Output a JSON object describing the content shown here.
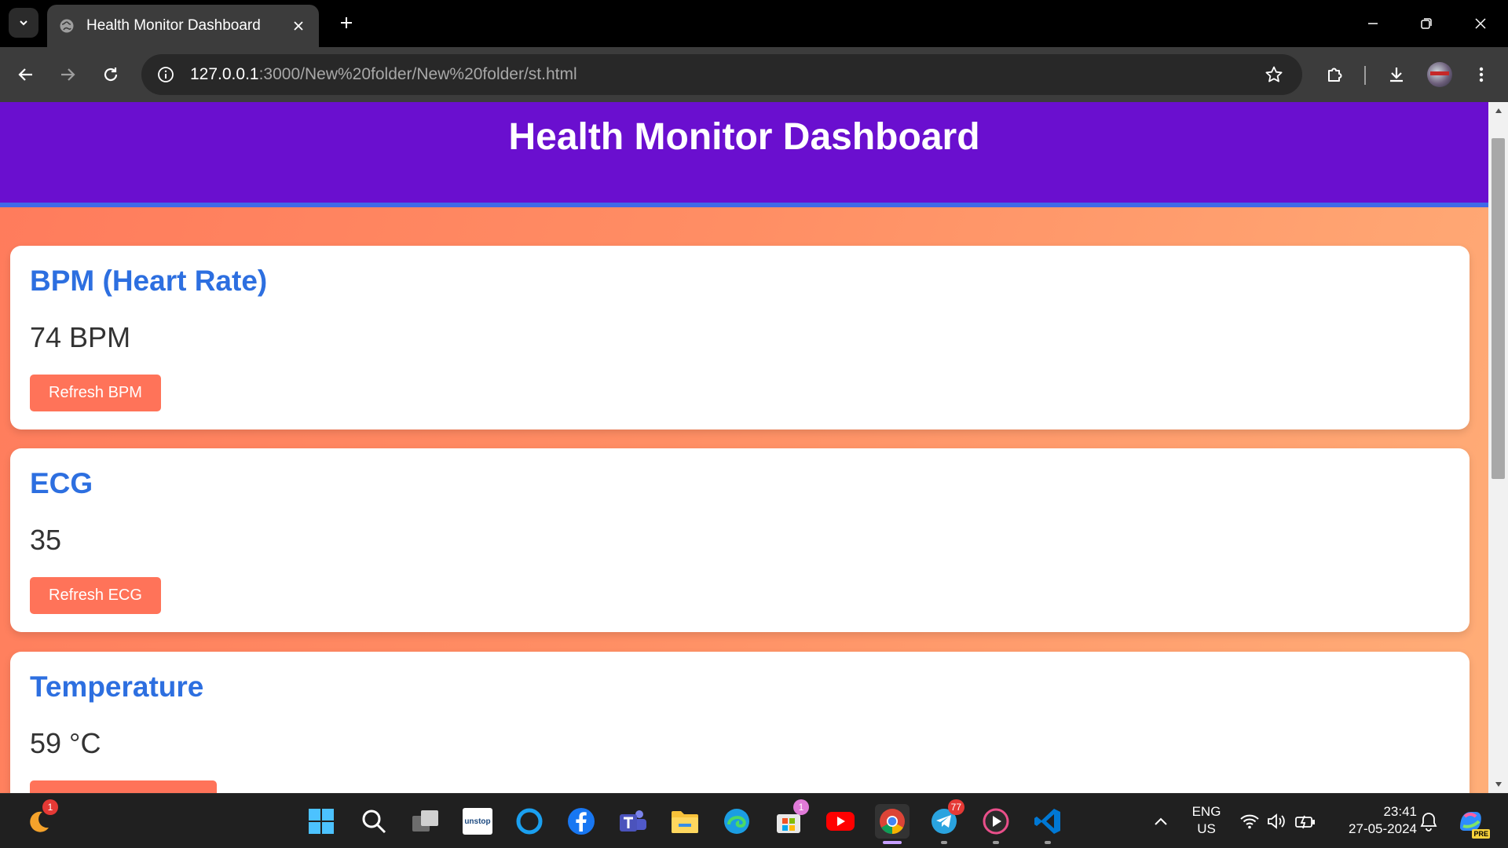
{
  "browser": {
    "tab_title": "Health Monitor Dashboard",
    "url_host": "127.0.0.1",
    "url_rest": ":3000/New%20folder/New%20folder/st.html"
  },
  "page": {
    "header_title": "Health Monitor Dashboard",
    "cards": [
      {
        "title": "BPM (Heart Rate)",
        "value": "74 BPM",
        "button": "Refresh BPM"
      },
      {
        "title": "ECG",
        "value": "35",
        "button": "Refresh ECG"
      },
      {
        "title": "Temperature",
        "value": "59 °C",
        "button": ""
      }
    ]
  },
  "taskbar": {
    "apps": [
      "weather",
      "start",
      "search",
      "task-view",
      "unstop",
      "cortana",
      "facebook",
      "teams",
      "file-explorer",
      "edge",
      "microsoft-store",
      "youtube",
      "chrome",
      "telegram",
      "media-player",
      "vscode"
    ],
    "unstop_label": "unstop",
    "weather_badge": "1",
    "store_badge": "1",
    "telegram_badge": "77",
    "lang_line1": "ENG",
    "lang_line2": "US",
    "time": "23:41",
    "date": "27-05-2024",
    "copilot_badge": "PRE"
  },
  "colors": {
    "header_bg": "#6a0fcf",
    "header_border": "#3f6ae8",
    "card_title": "#2d6fe0",
    "button_bg": "#ff7359",
    "page_gradient_start": "#ff7b5c",
    "page_gradient_end": "#ffae78"
  }
}
